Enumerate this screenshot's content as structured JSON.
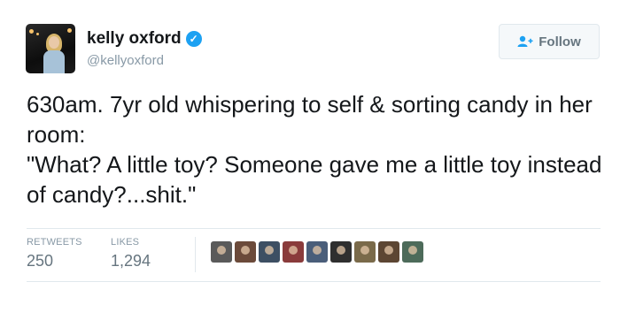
{
  "tweet": {
    "author": {
      "display_name": "kelly oxford",
      "handle": "@kellyoxford",
      "verified": true
    },
    "follow_button": {
      "label": "Follow",
      "icon": "add-user-icon"
    },
    "text_lines": [
      "630am. 7yr old whispering to self & sorting candy in her room:",
      "\"What? A little toy? Someone gave me a little toy instead of candy?...shit.\""
    ],
    "stats": {
      "retweets_label": "RETWEETS",
      "retweets_value": "250",
      "likes_label": "LIKES",
      "likes_value": "1,294"
    },
    "likers": [
      {
        "color": "#5a5a5a"
      },
      {
        "color": "#6b4a3a"
      },
      {
        "color": "#3d4f63"
      },
      {
        "color": "#8a3b3b"
      },
      {
        "color": "#4a5e7a"
      },
      {
        "color": "#2f2f2f"
      },
      {
        "color": "#7a6a4a"
      },
      {
        "color": "#5c4633"
      },
      {
        "color": "#4d6b5a"
      }
    ]
  }
}
